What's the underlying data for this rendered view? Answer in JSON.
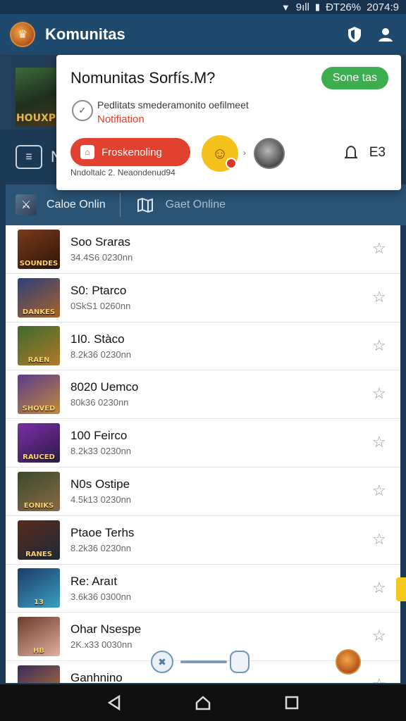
{
  "status_bar": {
    "battery": "9ıll",
    "signal": "ĐT26%",
    "time": "2074:9"
  },
  "app_bar": {
    "title": "Komunitas"
  },
  "banner": {
    "art_label": "HOUXP",
    "subnav_letter": "N"
  },
  "tabs": [
    {
      "label": "Caloe Onlin"
    },
    {
      "label": "Gaet Online"
    }
  ],
  "popup": {
    "title": "Nomunitas Sorfís.M?",
    "pill": "Sone tas",
    "description": "Pedlitats smederamonito oefilmeet",
    "notification": "Notifiation",
    "button": "Froskenoling",
    "count": "E3",
    "meta": "Nndoltalc 2. Neaondenud94"
  },
  "list": [
    {
      "title": "Soo Sraras",
      "sub": "34.4S6 0230nn",
      "thumb_label": "SOUNDES"
    },
    {
      "title": "S0: Ptarco",
      "sub": "0SkS1 0260nn",
      "thumb_label": "DANKES"
    },
    {
      "title": "1I0. Stàco",
      "sub": "8.2k36 0230nn",
      "thumb_label": "RAEN"
    },
    {
      "title": "8020 Uemco",
      "sub": "80k36 0230nn",
      "thumb_label": "SHOVED"
    },
    {
      "title": "100 Feirco",
      "sub": "8.2k33 0230nn",
      "thumb_label": "RAUCED"
    },
    {
      "title": "N0s Ostipe",
      "sub": "4.5k13 0230nn",
      "thumb_label": "EONIKS"
    },
    {
      "title": "Ptaoe Terhs",
      "sub": "8.2k36 0230nn",
      "thumb_label": "RANES"
    },
    {
      "title": "Re: Araıt",
      "sub": "3.6k36 0300nn",
      "thumb_label": "13"
    },
    {
      "title": "Ohar Nsespe",
      "sub": "2K.x33 0030nn",
      "thumb_label": "HB"
    },
    {
      "title": "Ganhnino",
      "sub": "",
      "thumb_label": ""
    }
  ],
  "thumb_colors": [
    [
      "#7a3b1c",
      "#2c1409"
    ],
    [
      "#2e3f7a",
      "#a7622a"
    ],
    [
      "#3d6a2c",
      "#b07a2a"
    ],
    [
      "#5a3b8c",
      "#c08a3a"
    ],
    [
      "#7b2fa8",
      "#2a1a44"
    ],
    [
      "#3a4a2a",
      "#8a6a4a"
    ],
    [
      "#5a2a1a",
      "#1c2a3a"
    ],
    [
      "#1d3a6a",
      "#3aa0c0"
    ],
    [
      "#6a3a2a",
      "#e0b0a0"
    ],
    [
      "#3a2a5a",
      "#c07a3a"
    ]
  ]
}
